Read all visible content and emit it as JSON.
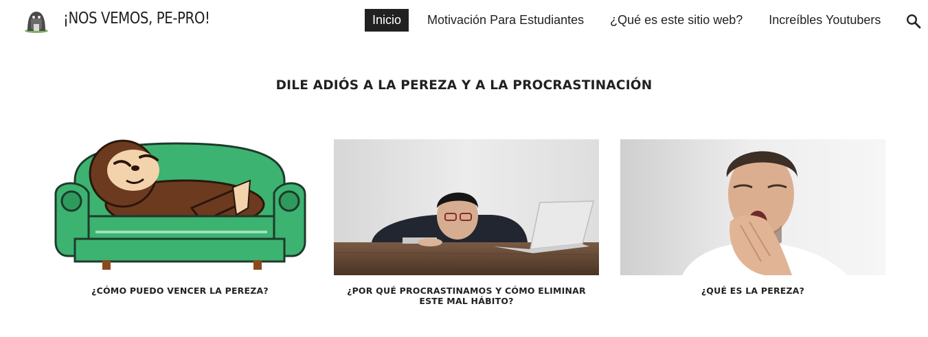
{
  "header": {
    "logo_icon": "sloth-logo-icon",
    "site_title": "¡NOS VEMOS, PE-PRO!",
    "nav": [
      {
        "label": "Inicio",
        "active": true
      },
      {
        "label": "Motivación Para Estudiantes",
        "active": false
      },
      {
        "label": "¿Qué es este sitio web?",
        "active": false
      },
      {
        "label": "Increíbles Youtubers",
        "active": false
      }
    ],
    "search_icon": "search-icon"
  },
  "main": {
    "heading": "DILE ADIÓS A LA PEREZA Y A LA PROCRASTINACIÓN",
    "cards": [
      {
        "image": "sloth-on-green-sofa-illustration",
        "caption": "¿CÓMO PUEDO VENCER LA PEREZA?"
      },
      {
        "image": "man-slumped-at-desk-with-laptop-photo",
        "caption": "¿POR QUÉ PROCRASTINAMOS Y CÓMO ELIMINAR ESTE MAL HÁBITO?"
      },
      {
        "image": "man-yawning-photo",
        "caption": "¿QUÉ ES LA PEREZA?"
      }
    ]
  },
  "colors": {
    "nav_active_bg": "#212121",
    "sofa_green": "#3cb371",
    "text": "#212121"
  }
}
